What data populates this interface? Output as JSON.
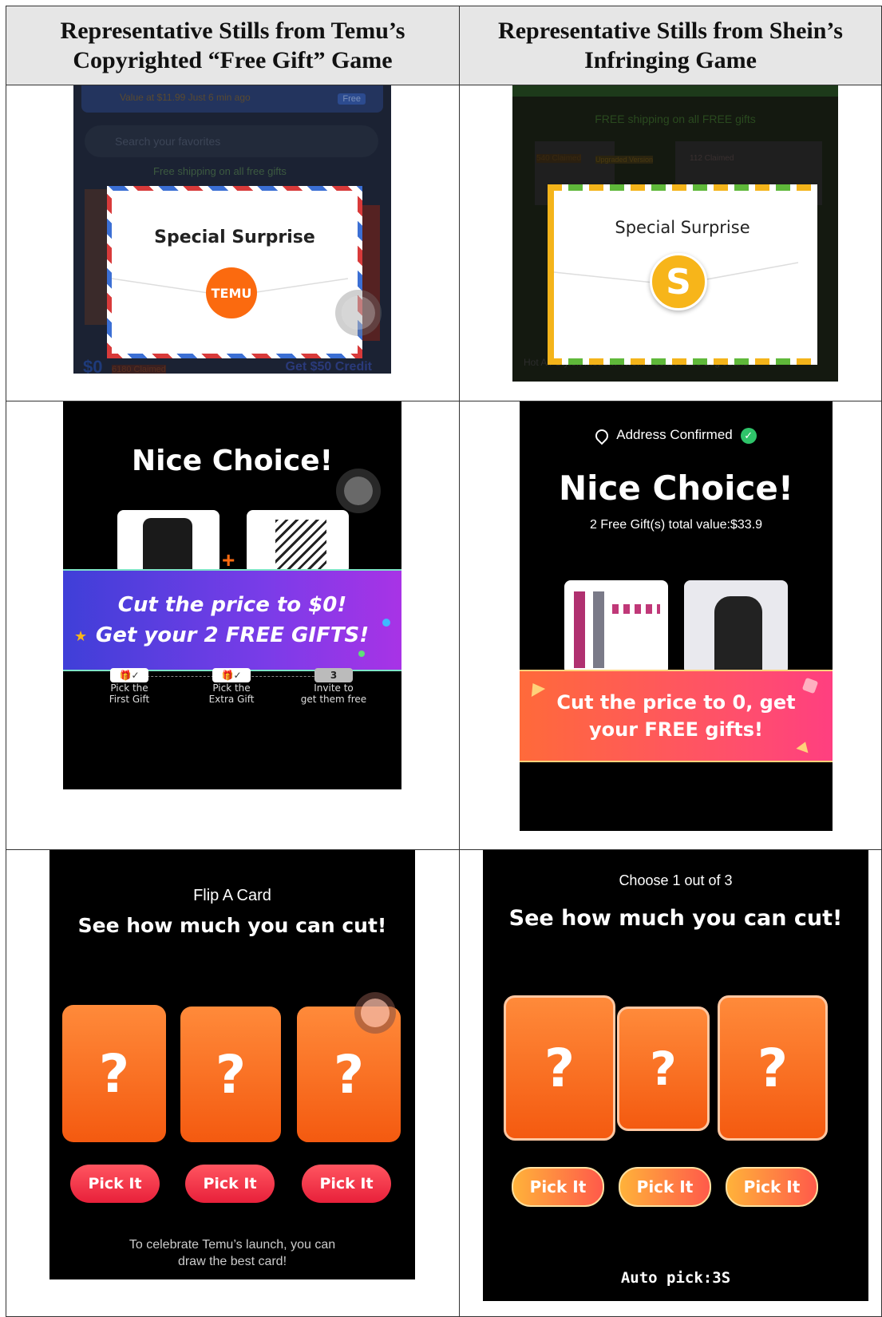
{
  "header": {
    "left_line1": "Representative Stills from Temu’s",
    "left_line2": "Copyrighted “Free Gift” Game",
    "right_line1": "Representative Stills from Shein’s",
    "right_line2": "Infringing Game"
  },
  "temu_row1": {
    "bg_top_text": "Value at $11.99  Just 6 min ago",
    "bg_free": "Free",
    "bg_search": "Search your favorites",
    "bg_shipping": "Free shipping on all free gifts",
    "bg_bottom_left": "$0",
    "bg_claimed": "6180 Claimed",
    "bg_credit": "Get $50 Credit",
    "envelope_title": "Special Surprise",
    "logo_text": "TEMU"
  },
  "shein_row1": {
    "bg_shipping": "FREE shipping on all FREE gifts",
    "bg_claimed1": "540 Claimed",
    "bg_upgraded": "Upgraded Version",
    "bg_claimed2": "112 Claimed",
    "bg_bottom": "Hot Air Styler, Modern Two... Pocket Flare Leg Jeans",
    "envelope_title": "Special Surprise",
    "logo_text": "S"
  },
  "temu_row2": {
    "title": "Nice Choice!",
    "plus": "+",
    "banner_line1": "Cut the price to $0!",
    "banner_line2": "Get your 2 FREE GIFTS!",
    "step1_chip": "🎁✓",
    "step1_line1": "Pick the",
    "step1_line2": "First Gift",
    "step2_chip": "🎁✓",
    "step2_line1": "Pick the",
    "step2_line2": "Extra Gift",
    "step3_chip": "3",
    "step3_line1": "Invite to",
    "step3_line2": "get them free"
  },
  "shein_row2": {
    "address": "Address Confirmed",
    "title": "Nice Choice!",
    "subtitle": "2 Free Gift(s) total value:$33.9",
    "banner_line1": "Cut the price to 0, get",
    "banner_line2": "your FREE gifts!"
  },
  "temu_row3": {
    "small_title": "Flip A Card",
    "title": "See how much you can cut!",
    "card_mark": "?",
    "pick_labels": [
      "Pick It",
      "Pick It",
      "Pick It"
    ],
    "footer_line1": "To celebrate Temu’s launch, you can",
    "footer_line2": "draw the best card!"
  },
  "shein_row3": {
    "small_title": "Choose 1 out of 3",
    "title": "See how much you can cut!",
    "card_mark": "?",
    "pick_labels": [
      "Pick It",
      "Pick It",
      "Pick It"
    ],
    "auto_pick": "Auto pick:3S"
  },
  "colors": {
    "temu_orange": "#fb6a0f",
    "shein_yellow": "#f7b51a",
    "pink_button": "#f23a4c"
  }
}
